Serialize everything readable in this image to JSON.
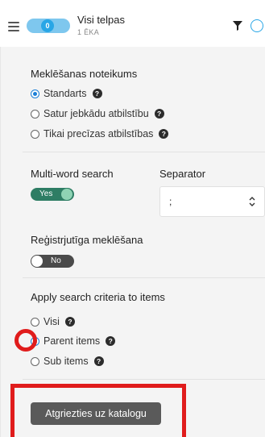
{
  "header": {
    "count": "0",
    "title": "Visi telpas",
    "subtitle": "1 ĒKA"
  },
  "search_rule": {
    "title": "Meklēšanas noteikums",
    "options": [
      {
        "label": "Standarts",
        "checked": true
      },
      {
        "label": "Satur jebkādu atbilstību",
        "checked": false
      },
      {
        "label": "Tikai precīzas atbilstības",
        "checked": false
      }
    ]
  },
  "multi_word": {
    "title": "Multi-word search",
    "toggle_label": "Yes"
  },
  "separator": {
    "title": "Separator",
    "value": ";"
  },
  "case_sensitive": {
    "title": "Reģistrjutīga meklēšana",
    "toggle_label": "No"
  },
  "apply_criteria": {
    "title": "Apply search criteria to items",
    "options": [
      {
        "label": "Visi",
        "checked": false
      },
      {
        "label": "Parent items",
        "checked": true
      },
      {
        "label": "Sub items",
        "checked": false
      }
    ]
  },
  "return_button": "Atgriezties uz katalogu",
  "colors": {
    "accent": "#29a6e6",
    "toggle_on": "#2e7d64",
    "annotation": "#e01c1c"
  },
  "help_glyph": "?"
}
